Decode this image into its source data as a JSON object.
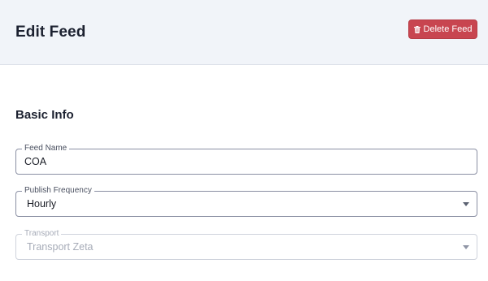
{
  "header": {
    "title": "Edit Feed",
    "delete_button": {
      "label": "Delete Feed",
      "icon": "trash-icon",
      "color": "#c84550"
    }
  },
  "form": {
    "section_title": "Basic Info",
    "feed_name": {
      "label": "Feed Name",
      "value": "COA"
    },
    "publish_frequency": {
      "label": "Publish Frequency",
      "value": "Hourly"
    },
    "transport": {
      "label": "Transport",
      "value": "Transport Zeta",
      "disabled": true
    }
  }
}
